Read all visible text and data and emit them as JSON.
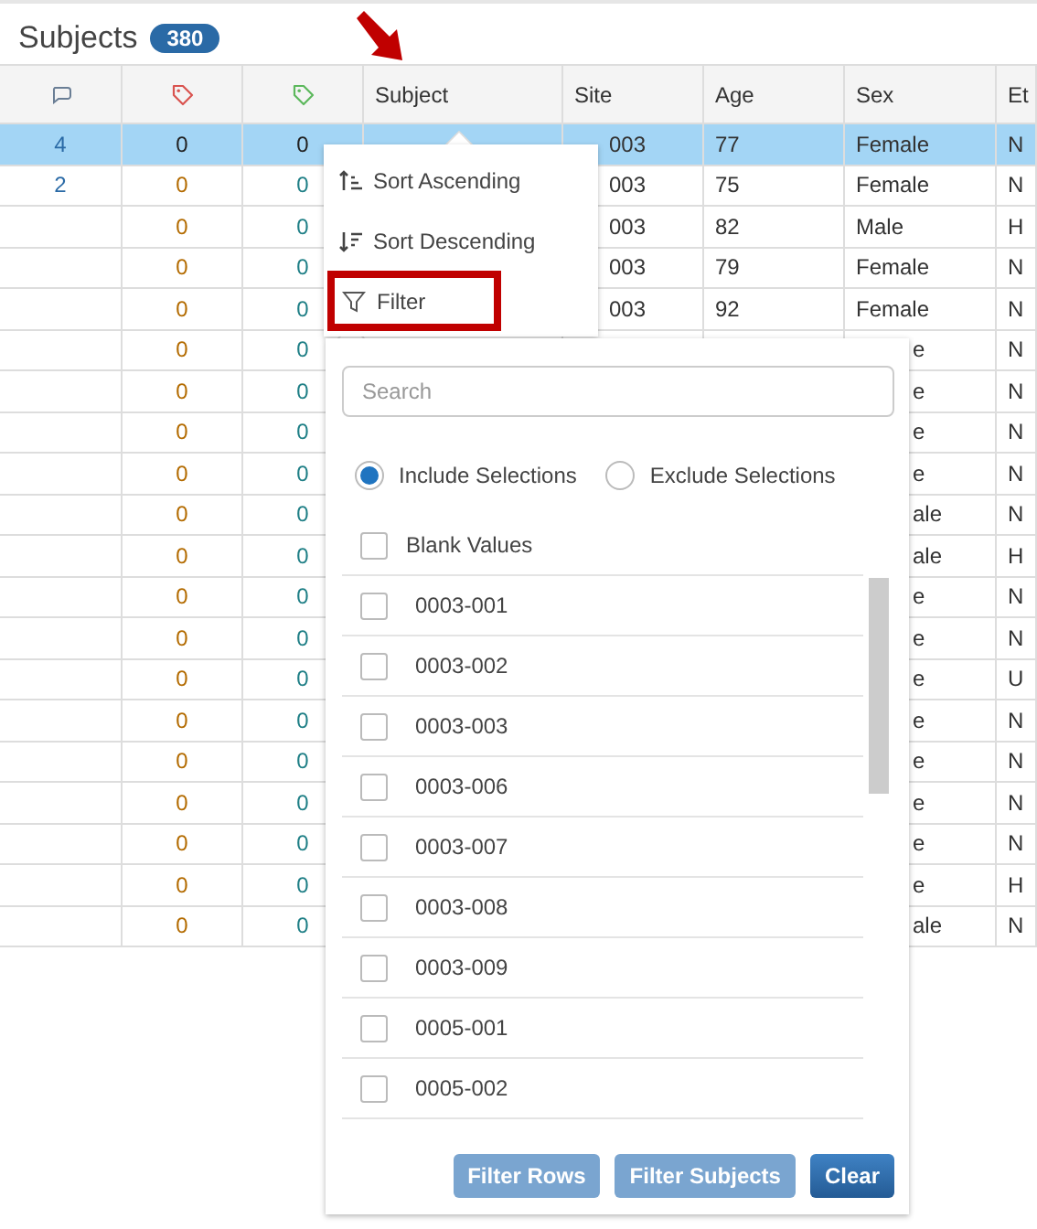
{
  "header": {
    "title": "Subjects",
    "count": "380"
  },
  "table": {
    "columns": [
      {
        "kind": "comment"
      },
      {
        "kind": "tag",
        "color": "#d9534f"
      },
      {
        "kind": "tag",
        "color": "#5cb85c"
      },
      {
        "kind": "text",
        "label": "Subject"
      },
      {
        "kind": "text",
        "label": "Site"
      },
      {
        "kind": "text",
        "label": "Age"
      },
      {
        "kind": "text",
        "label": "Sex"
      },
      {
        "kind": "text",
        "label": "Et"
      }
    ],
    "pointer_arrow": true,
    "rows": [
      {
        "selected": true,
        "covered": false,
        "comments": "4",
        "tag_red": "0",
        "tag_green": "0",
        "site": "003",
        "age": "77",
        "sex": "Female",
        "column_8": "N"
      },
      {
        "selected": false,
        "covered": false,
        "comments": "2",
        "tag_red": "0",
        "tag_green": "0",
        "site": "003",
        "age": "75",
        "sex": "Female",
        "column_8": "N"
      },
      {
        "selected": false,
        "covered": false,
        "tag_red": "0",
        "tag_green": "0",
        "site": "003",
        "age": "82",
        "sex": "Male",
        "column_8": "H"
      },
      {
        "selected": false,
        "covered": false,
        "tag_red": "0",
        "tag_green": "0",
        "site": "003",
        "age": "79",
        "sex": "Female",
        "column_8": "N"
      },
      {
        "selected": false,
        "covered": false,
        "tag_red": "0",
        "tag_green": "0",
        "site": "003",
        "age": "92",
        "sex": "Female",
        "column_8": "N"
      },
      {
        "selected": false,
        "covered": true,
        "tag_red": "0",
        "tag_green": "0",
        "sex": "e",
        "column_8": "N"
      },
      {
        "selected": false,
        "covered": true,
        "tag_red": "0",
        "tag_green": "0",
        "sex": "e",
        "column_8": "N"
      },
      {
        "selected": false,
        "covered": true,
        "tag_red": "0",
        "tag_green": "0",
        "sex": "e",
        "column_8": "N"
      },
      {
        "selected": false,
        "covered": true,
        "tag_red": "0",
        "tag_green": "0",
        "sex": "e",
        "column_8": "N"
      },
      {
        "selected": false,
        "covered": true,
        "tag_red": "0",
        "tag_green": "0",
        "sex": "ale",
        "column_8": "N"
      },
      {
        "selected": false,
        "covered": true,
        "tag_red": "0",
        "tag_green": "0",
        "sex": "ale",
        "column_8": "H"
      },
      {
        "selected": false,
        "covered": true,
        "tag_red": "0",
        "tag_green": "0",
        "sex": "e",
        "column_8": "N"
      },
      {
        "selected": false,
        "covered": true,
        "tag_red": "0",
        "tag_green": "0",
        "sex": "e",
        "column_8": "N"
      },
      {
        "selected": false,
        "covered": true,
        "tag_red": "0",
        "tag_green": "0",
        "sex": "e",
        "column_8": "U"
      },
      {
        "selected": false,
        "covered": true,
        "tag_red": "0",
        "tag_green": "0",
        "sex": "e",
        "column_8": "N"
      },
      {
        "selected": false,
        "covered": true,
        "tag_red": "0",
        "tag_green": "0",
        "sex": "e",
        "column_8": "N"
      },
      {
        "selected": false,
        "covered": true,
        "tag_red": "0",
        "tag_green": "0",
        "sex": "e",
        "column_8": "N"
      },
      {
        "selected": false,
        "covered": true,
        "tag_red": "0",
        "tag_green": "0",
        "sex": "e",
        "column_8": "N"
      },
      {
        "selected": false,
        "covered": true,
        "tag_red": "0",
        "tag_green": "0",
        "sex": "e",
        "column_8": "H"
      },
      {
        "selected": false,
        "covered": true,
        "tag_red": "0",
        "tag_green": "0",
        "sex": "ale",
        "column_8": "N"
      }
    ]
  },
  "column_menu": {
    "items": [
      {
        "kind": "sort-ascending",
        "label": "Sort Ascending",
        "highlighted": false
      },
      {
        "kind": "sort-descending",
        "label": "Sort Descending",
        "highlighted": false
      },
      {
        "kind": "filter",
        "label": "Filter",
        "highlighted": true
      }
    ]
  },
  "filter_panel": {
    "search": {
      "placeholder": "Search"
    },
    "modes": [
      {
        "label": "Include Selections",
        "selected": true
      },
      {
        "label": "Exclude Selections",
        "selected": false
      }
    ],
    "blank_option": {
      "label": "Blank Values",
      "checked": false
    },
    "options": [
      {
        "label": "0003-001",
        "checked": false
      },
      {
        "label": "0003-002",
        "checked": false
      },
      {
        "label": "0003-003",
        "checked": false
      },
      {
        "label": "0003-006",
        "checked": false
      },
      {
        "label": "0003-007",
        "checked": false
      },
      {
        "label": "0003-008",
        "checked": false
      },
      {
        "label": "0003-009",
        "checked": false
      },
      {
        "label": "0005-001",
        "checked": false
      },
      {
        "label": "0005-002",
        "checked": false
      }
    ],
    "buttons": [
      {
        "label": "Filter Rows",
        "disabled": true
      },
      {
        "label": "Filter Subjects",
        "disabled": true
      },
      {
        "label": "Clear",
        "disabled": false
      }
    ]
  }
}
